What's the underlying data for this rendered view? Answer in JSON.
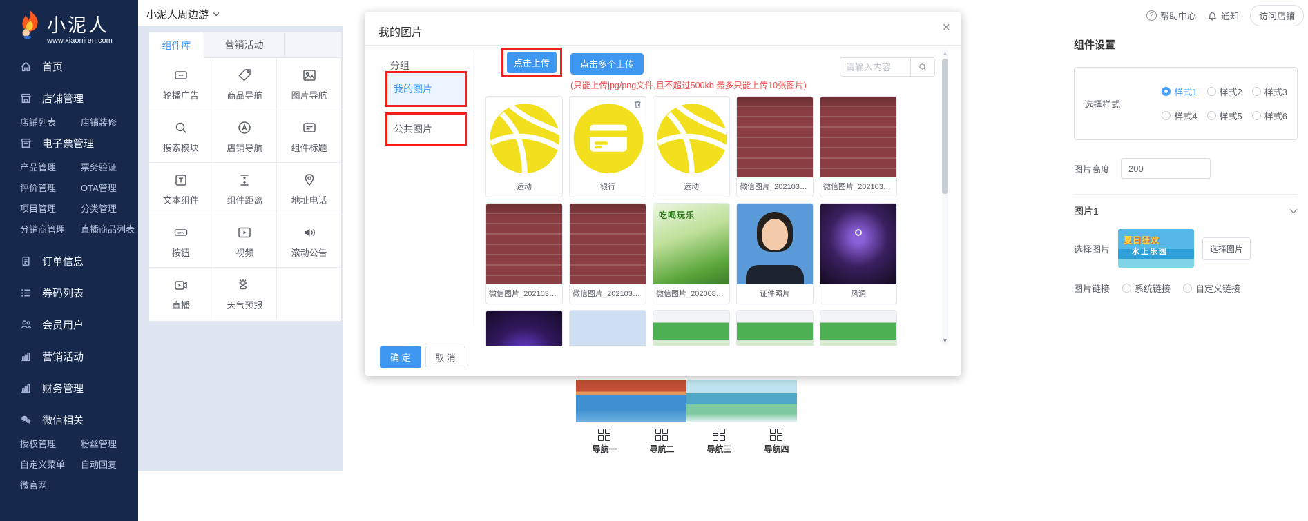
{
  "topbar": {
    "title": "小泥人周边游",
    "help": "帮助中心",
    "notice": "通知",
    "visit": "访问店铺"
  },
  "brand": {
    "name": "小泥人",
    "site": "www.xiaoniren.com"
  },
  "sidebar": {
    "home": "首页",
    "shop": "店铺管理",
    "shop_sub": [
      "店铺列表",
      "店铺装修"
    ],
    "ticket": "电子票管理",
    "ticket_sub": [
      "产品管理",
      "票务验证",
      "评价管理",
      "OTA管理",
      "项目管理",
      "分类管理",
      "分销商管理",
      "直播商品列表"
    ],
    "order": "订单信息",
    "coupon": "券码列表",
    "member": "会员用户",
    "marketing": "营销活动",
    "finance": "财务管理",
    "wechat": "微信相关",
    "wechat_sub": [
      "授权管理",
      "粉丝管理",
      "自定义菜单",
      "自动回复",
      "微官网"
    ]
  },
  "panel": {
    "tabs": [
      "组件库",
      "营销活动"
    ],
    "items": [
      "轮播广告",
      "商品导航",
      "图片导航",
      "搜索模块",
      "店铺导航",
      "组件标题",
      "文本组件",
      "组件距离",
      "地址电话",
      "按钮",
      "视频",
      "滚动公告",
      "直播",
      "天气预报"
    ]
  },
  "modal": {
    "title": "我的图片",
    "group_label": "分组",
    "groups": [
      {
        "label": "我的图片"
      },
      {
        "label": "公共图片"
      }
    ],
    "upload": "点击上传",
    "multi_upload": "点击多个上传",
    "hint": "(只能上传jpg/png文件,且不超过500kb,最多只能上传10张图片)",
    "search_placeholder": "请输入内容",
    "cards": [
      {
        "caption": "运动"
      },
      {
        "caption": "银行"
      },
      {
        "caption": "运动"
      },
      {
        "caption": "微信图片_2021030..."
      },
      {
        "caption": "微信图片_2021030..."
      },
      {
        "caption": "微信图片_2021030..."
      },
      {
        "caption": "微信图片_2021030..."
      },
      {
        "caption": "微信图片_2020082..."
      },
      {
        "caption": "证件照片"
      },
      {
        "caption": "风洞"
      }
    ],
    "poster_text": "吃喝玩乐",
    "confirm": "确 定",
    "cancel": "取 消"
  },
  "preview": {
    "nav": [
      "导航一",
      "导航二",
      "导航三",
      "导航四"
    ]
  },
  "settings": {
    "title": "组件设置",
    "style_label": "选择样式",
    "styles": [
      "样式1",
      "样式2",
      "样式3",
      "样式4",
      "样式5",
      "样式6"
    ],
    "selected_style": "样式1",
    "height_label": "图片高度",
    "height_value": "200",
    "image_group": "图片1",
    "pick_label": "选择图片",
    "pick_button": "选择图片",
    "thumb_text_1": "夏日狂欢",
    "thumb_text_2": "水上乐园",
    "link_label": "图片链接",
    "link_options": [
      "系统链接",
      "自定义链接"
    ]
  },
  "colors": {
    "accent": "#409eff",
    "danger_outline": "#f21f1f",
    "hint_red": "#f34d4d",
    "sidebar_bg": "#16294d",
    "thumb_yellow": "#f2df1e"
  }
}
